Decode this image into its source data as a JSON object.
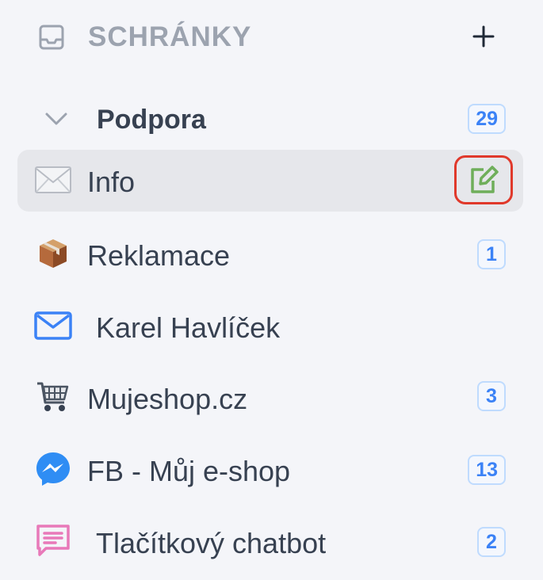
{
  "header": {
    "title": "SCHRÁNKY",
    "add_icon": "plus-icon",
    "inbox_icon": "inbox-icon"
  },
  "group": {
    "label": "Podpora",
    "count": "29",
    "collapse_icon": "chevron-down-icon"
  },
  "items": [
    {
      "label": "Info",
      "icon": "envelope-icon",
      "badge": null,
      "active": true,
      "action_icon": "edit-icon",
      "action_color": "#e0392b"
    },
    {
      "label": "Reklamace",
      "icon": "package-icon",
      "badge": "1"
    },
    {
      "label": "Karel Havlíček",
      "icon": "mail-icon",
      "badge": null
    },
    {
      "label": "Mujeshop.cz",
      "icon": "cart-icon",
      "badge": "3"
    },
    {
      "label": "FB - Můj e-shop",
      "icon": "messenger-icon",
      "badge": "13"
    },
    {
      "label": "Tlačítkový chatbot",
      "icon": "chat-icon",
      "badge": "2"
    }
  ],
  "colors": {
    "background": "#f4f5f9",
    "badge_text": "#3b82f6",
    "badge_border": "#bfdbfe",
    "edit_icon": "#6fae5a",
    "highlight": "#e0392b"
  }
}
